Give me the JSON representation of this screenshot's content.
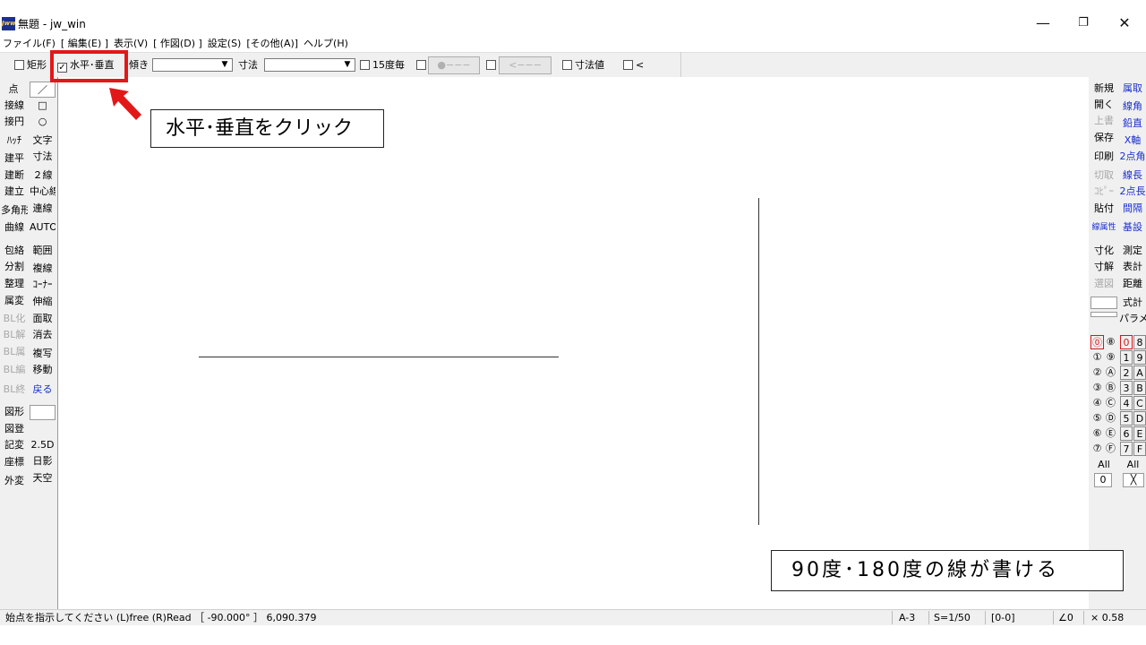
{
  "window": {
    "title": "無題 - jw_win",
    "icon_text": "Jww",
    "minimize": "—",
    "restore": "❐",
    "close": "✕"
  },
  "menu": [
    "ファイル(F)",
    "[ 編集(E) ]",
    "表示(V)",
    "[ 作図(D) ]",
    "設定(S)",
    "[その他(A)]",
    "ヘルプ(H)"
  ],
  "toolbar": {
    "rect_label": "矩形",
    "rect_checked": false,
    "hv_label": "水平･垂直",
    "hv_checked": true,
    "tilt_label": "傾き",
    "dim_label": "寸法",
    "deg15_label": "15度毎",
    "circle_btn": "●−−−",
    "arrow_btn": "<−−−",
    "dimval_label": "寸法値",
    "lt_label": "<"
  },
  "left_tools": [
    [
      "点",
      "／"
    ],
    [
      "接線",
      "□"
    ],
    [
      "接円",
      "○"
    ],
    [
      "ﾊｯﾁ",
      "文字"
    ],
    [
      "建平",
      "寸法"
    ],
    [
      "建断",
      "２線"
    ],
    [
      "建立",
      "中心線"
    ],
    [
      "多角形",
      "連線"
    ],
    [
      "曲線",
      "AUTO"
    ],
    [
      "包絡",
      "範囲"
    ],
    [
      "分割",
      "複線"
    ],
    [
      "整理",
      "ｺｰﾅｰ"
    ],
    [
      "属変",
      "伸縮"
    ],
    [
      "BL化",
      "面取"
    ],
    [
      "BL解",
      "消去"
    ],
    [
      "BL属",
      "複写"
    ],
    [
      "BL編",
      "移動"
    ],
    [
      "BL終",
      "戻る"
    ],
    [
      "図形",
      ""
    ],
    [
      "図登",
      ""
    ],
    [
      "記変",
      "2.5D"
    ],
    [
      "座標",
      "日影"
    ],
    [
      "外変",
      "天空"
    ]
  ],
  "right_tools": [
    [
      "新規",
      "属取"
    ],
    [
      "開く",
      "線角"
    ],
    [
      "上書",
      "鉛直"
    ],
    [
      "保存",
      "X軸"
    ],
    [
      "印刷",
      "2点角"
    ],
    [
      "切取",
      "線長"
    ],
    [
      "ｺﾋﾟｰ",
      "2点長"
    ],
    [
      "貼付",
      "間隔"
    ],
    [
      "線属性",
      "基設"
    ],
    [
      "寸化",
      "測定"
    ],
    [
      "寸解",
      "表計"
    ],
    [
      "選図",
      "距離"
    ],
    [
      "",
      "式計"
    ],
    [
      "",
      "パラメ"
    ]
  ],
  "layers": {
    "left_a": [
      "⓪",
      "①",
      "②",
      "③",
      "④",
      "⑤",
      "⑥",
      "⑦"
    ],
    "left_b": [
      "⑧",
      "⑨",
      "Ⓐ",
      "Ⓑ",
      "Ⓒ",
      "Ⓓ",
      "Ⓔ",
      "Ⓕ"
    ],
    "right_a": [
      "0",
      "1",
      "2",
      "3",
      "4",
      "5",
      "6",
      "7"
    ],
    "right_b": [
      "8",
      "9",
      "A",
      "B",
      "C",
      "D",
      "E",
      "F"
    ],
    "all": "All",
    "zero": "0",
    "x_btn": "╳"
  },
  "status": {
    "message": "始点を指示してください  (L)free  (R)Read  ［ -90.000° ］ 6,090.379",
    "paper": "A-3",
    "scale": "S=1/50",
    "layer": "[0-0]",
    "angle": "∠0",
    "zoom": "× 0.58"
  },
  "annotations": {
    "callout1": "水平･垂直をクリック",
    "callout2": "90度･180度の線が書ける"
  },
  "colors": {
    "accent_red": "#e21818",
    "blue_text": "#1a2fd0",
    "disabled_text": "#a8a8a8"
  }
}
